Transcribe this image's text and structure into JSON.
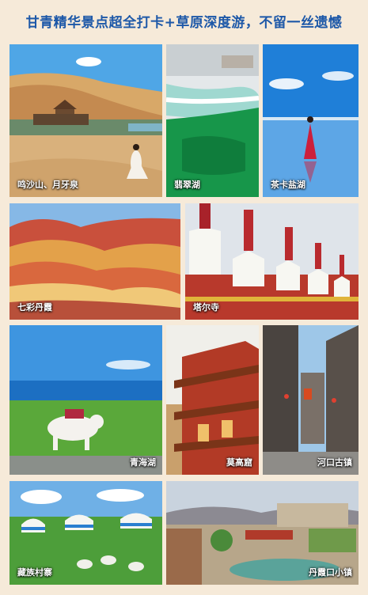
{
  "header": {
    "title": "甘青精华景点超全打卡+草原深度游，不留一丝遗憾"
  },
  "tiles": {
    "mingsha": {
      "label": "鸣沙山、月牙泉"
    },
    "feicui": {
      "label": "翡翠湖"
    },
    "chaka": {
      "label": "茶卡盐湖"
    },
    "danxia": {
      "label": "七彩丹霞"
    },
    "taer": {
      "label": "塔尔寺"
    },
    "qinghai": {
      "label": "青海湖"
    },
    "mogao": {
      "label": "莫高窟"
    },
    "hekou": {
      "label": "河口古镇"
    },
    "zangzu": {
      "label": "藏族村寨"
    },
    "danxiakou": {
      "label": "丹霞口小镇"
    }
  },
  "colors": {
    "background": "#f6ead9",
    "title": "#1d58a8",
    "caption": "#ffffff"
  }
}
